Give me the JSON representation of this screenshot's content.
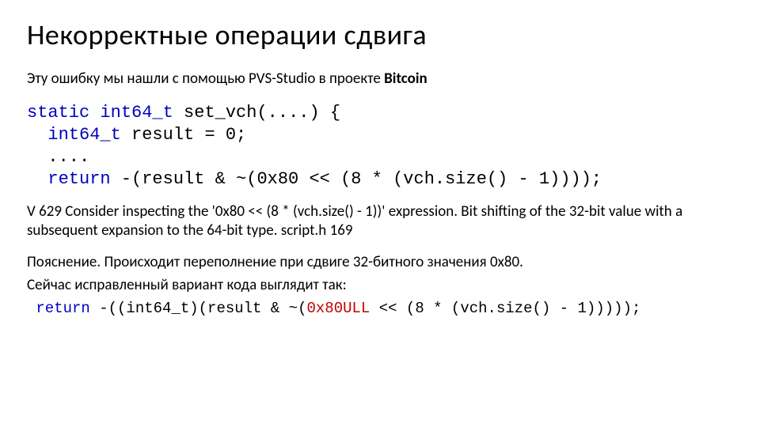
{
  "title": "Некорректные операции сдвига",
  "subtitle_prefix": "Эту ошибку мы нашли с помощью PVS-Studio в проекте ",
  "subtitle_bold": "Bitcoin",
  "code": {
    "l1_kw1": "static",
    "l1_kw2": "int64_t",
    "l1_rest": " set_vch(....) {",
    "l2_kw": "int64_t",
    "l2_rest": " result = 0;",
    "l3": "  ....",
    "l4_kw": "return",
    "l4_rest": " -(result & ~(0x80 << (8 * (vch.size() - 1))));"
  },
  "diag": "V 629 Consider inspecting the '0x80 << (8 * (vch.size() - 1))' expression. Bit shifting of the 32-bit value with a subsequent expansion to the 64-bit type. script.h 169",
  "expl_line1": "Пояснение. Происходит переполнение при сдвиге 32-битного значения 0x80.",
  "expl_line2": "Сейчас исправленный вариант кода выглядит так:",
  "fix": {
    "kw": "return",
    "mid1": " -((int64_t)(result & ~(",
    "hl": "0x80ULL",
    "mid2": " << (8 * (vch.size() - 1)))));"
  }
}
